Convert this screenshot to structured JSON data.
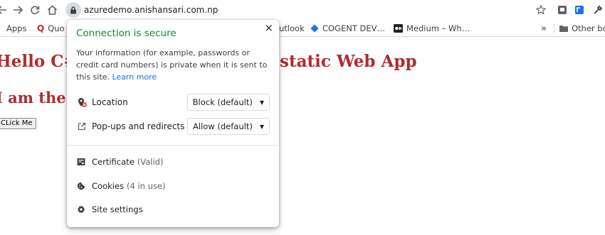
{
  "toolbar": {
    "back_icon": "back-arrow-icon",
    "forward_icon": "forward-arrow-icon",
    "reload_icon": "reload-icon",
    "home_icon": "home-icon",
    "url": "azuredemo.anishansari.com.np"
  },
  "bookmarks": {
    "items": [
      {
        "label": "Apps",
        "icon": "apps-grid-icon"
      },
      {
        "label": "Quo",
        "icon": "quora-icon"
      },
      {
        "label": "utlook",
        "icon": "outlook-icon"
      },
      {
        "label": "COGENT DEV…",
        "icon": "cogent-diamond-icon"
      },
      {
        "label": "Medium – Wh…",
        "icon": "medium-icon"
      }
    ],
    "overflow": "»",
    "other_label": "Other bo"
  },
  "page": {
    "heading1_left": "Hello C# ",
    "heading1_right": "static Web App",
    "heading2": "I am the n",
    "button_label": "CLick Me"
  },
  "popup": {
    "title": "Connection is secure",
    "close": "×",
    "desc_line1": "Your information (for example, passwords or",
    "desc_line2": "credit card numbers) is private when it is sent to",
    "desc_line3": "this site.",
    "learn_more": "Learn more",
    "permissions": [
      {
        "label": "Location",
        "value": "Block (default)",
        "icon": "location-blocked-icon"
      },
      {
        "label": "Pop-ups and redirects",
        "value": "Allow (default)",
        "icon": "popup-icon"
      }
    ],
    "certificate_label": "Certificate",
    "certificate_status": "(Valid)",
    "cookies_label": "Cookies",
    "cookies_status": "(4 in use)",
    "site_settings_label": "Site settings"
  },
  "colors": {
    "secure_green": "#188038",
    "heading_red": "#b02c2c",
    "link_blue": "#1a73e8"
  }
}
